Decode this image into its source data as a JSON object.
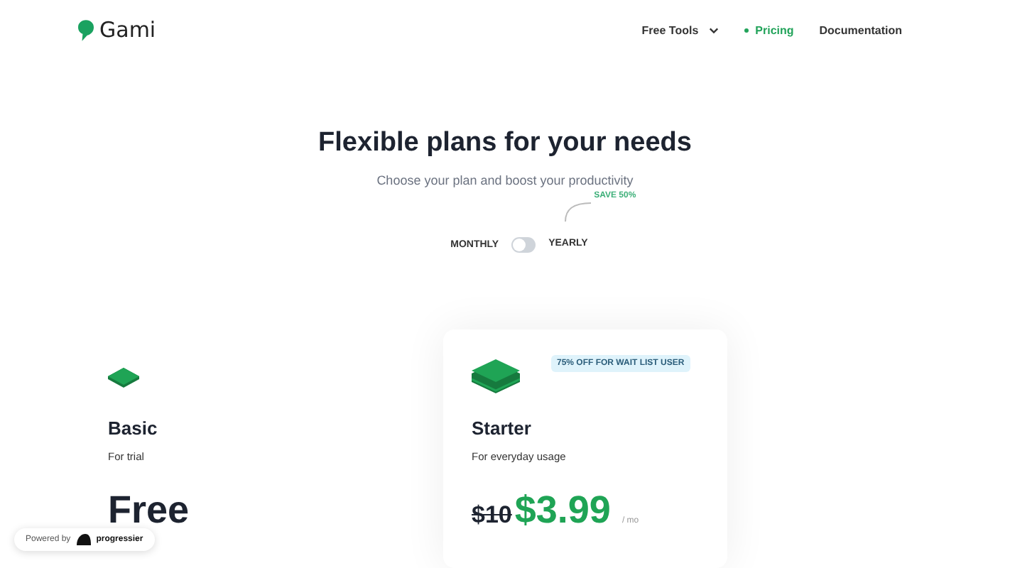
{
  "brand": {
    "name": "Gami"
  },
  "nav": [
    {
      "label": "Free Tools",
      "kind": "dropdown",
      "selected": false
    },
    {
      "label": "Pricing",
      "kind": "link",
      "selected": true
    },
    {
      "label": "Documentation",
      "kind": "link",
      "selected": false
    }
  ],
  "hero": {
    "title": "Flexible plans for your needs",
    "subtitle": "Choose your plan and boost your productivity"
  },
  "billing": {
    "left_label": "MONTHLY",
    "right_label": "YEARLY",
    "on": false,
    "note": "SAVE 50%"
  },
  "plans": [
    {
      "name": "Basic",
      "tagline": "For trial",
      "price": "Free",
      "kind": "plain"
    },
    {
      "name": "Starter",
      "tagline": "For everyday usage",
      "badge": "75% OFF FOR WAIT LIST USER",
      "old_price": "$10",
      "price": "$3.99",
      "period": "/ mo",
      "kind": "featured"
    }
  ],
  "powered_by": {
    "label": "Powered by",
    "brand": "progressier"
  }
}
